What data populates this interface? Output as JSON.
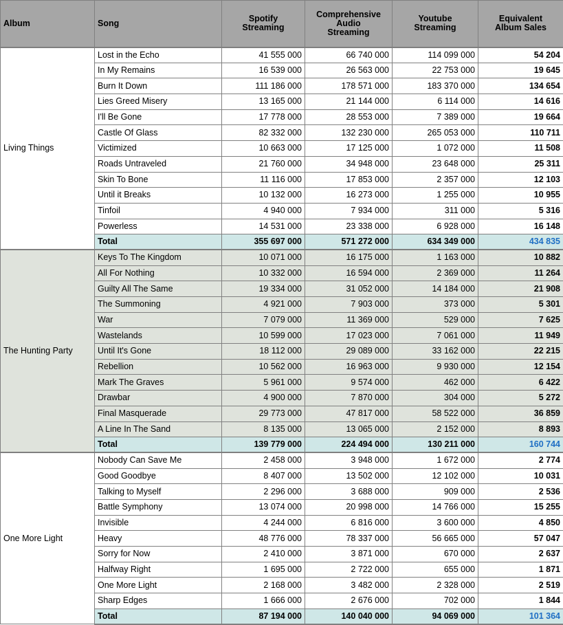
{
  "table": {
    "headers": {
      "album": "Album",
      "song": "Song",
      "spotify": "Spotify Streaming",
      "spotify_line1": "Spotify",
      "spotify_line2": "Streaming",
      "comprehensive_line1": "Comprehensive",
      "comprehensive_line2": "Audio",
      "comprehensive_line3": "Streaming",
      "youtube_line1": "Youtube",
      "youtube_line2": "Streaming",
      "equivalent_line1": "Equivalent",
      "equivalent_line2": "Album Sales"
    },
    "total_label": "Total",
    "colors": {
      "header_bg": "#a6a6a6",
      "total_bg": "#cfe7e7",
      "total_accent_text": "#1f6fc4",
      "section_tint": "#dfe3dc",
      "grid_line": "#808080"
    },
    "sections": [
      {
        "album": "Living Things",
        "rows": [
          {
            "song": "Lost in the Echo",
            "spotify": "41 555 000",
            "comprehensive": "66 740 000",
            "youtube": "114 099 000",
            "equivalent": "54 204"
          },
          {
            "song": "In My Remains",
            "spotify": "16 539 000",
            "comprehensive": "26 563 000",
            "youtube": "22 753 000",
            "equivalent": "19 645"
          },
          {
            "song": "Burn It Down",
            "spotify": "111 186 000",
            "comprehensive": "178 571 000",
            "youtube": "183 370 000",
            "equivalent": "134 654"
          },
          {
            "song": "Lies Greed Misery",
            "spotify": "13 165 000",
            "comprehensive": "21 144 000",
            "youtube": "6 114 000",
            "equivalent": "14 616"
          },
          {
            "song": "I'll Be Gone",
            "spotify": "17 778 000",
            "comprehensive": "28 553 000",
            "youtube": "7 389 000",
            "equivalent": "19 664"
          },
          {
            "song": "Castle Of Glass",
            "spotify": "82 332 000",
            "comprehensive": "132 230 000",
            "youtube": "265 053 000",
            "equivalent": "110 711"
          },
          {
            "song": "Victimized",
            "spotify": "10 663 000",
            "comprehensive": "17 125 000",
            "youtube": "1 072 000",
            "equivalent": "11 508"
          },
          {
            "song": "Roads Untraveled",
            "spotify": "21 760 000",
            "comprehensive": "34 948 000",
            "youtube": "23 648 000",
            "equivalent": "25 311"
          },
          {
            "song": "Skin To Bone",
            "spotify": "11 116 000",
            "comprehensive": "17 853 000",
            "youtube": "2 357 000",
            "equivalent": "12 103"
          },
          {
            "song": "Until it Breaks",
            "spotify": "10 132 000",
            "comprehensive": "16 273 000",
            "youtube": "1 255 000",
            "equivalent": "10 955"
          },
          {
            "song": "Tinfoil",
            "spotify": "4 940 000",
            "comprehensive": "7 934 000",
            "youtube": "311 000",
            "equivalent": "5 316"
          },
          {
            "song": "Powerless",
            "spotify": "14 531 000",
            "comprehensive": "23 338 000",
            "youtube": "6 928 000",
            "equivalent": "16 148"
          }
        ],
        "total": {
          "song": "Total",
          "spotify": "355 697 000",
          "comprehensive": "571 272 000",
          "youtube": "634 349 000",
          "equivalent": "434 835"
        }
      },
      {
        "album": "The Hunting Party",
        "rows": [
          {
            "song": "Keys To The Kingdom",
            "spotify": "10 071 000",
            "comprehensive": "16 175 000",
            "youtube": "1 163 000",
            "equivalent": "10 882"
          },
          {
            "song": "All For Nothing",
            "spotify": "10 332 000",
            "comprehensive": "16 594 000",
            "youtube": "2 369 000",
            "equivalent": "11 264"
          },
          {
            "song": "Guilty All The Same",
            "spotify": "19 334 000",
            "comprehensive": "31 052 000",
            "youtube": "14 184 000",
            "equivalent": "21 908"
          },
          {
            "song": "The Summoning",
            "spotify": "4 921 000",
            "comprehensive": "7 903 000",
            "youtube": "373 000",
            "equivalent": "5 301"
          },
          {
            "song": "War",
            "spotify": "7 079 000",
            "comprehensive": "11 369 000",
            "youtube": "529 000",
            "equivalent": "7 625"
          },
          {
            "song": "Wastelands",
            "spotify": "10 599 000",
            "comprehensive": "17 023 000",
            "youtube": "7 061 000",
            "equivalent": "11 949"
          },
          {
            "song": "Until It's Gone",
            "spotify": "18 112 000",
            "comprehensive": "29 089 000",
            "youtube": "33 162 000",
            "equivalent": "22 215"
          },
          {
            "song": "Rebellion",
            "spotify": "10 562 000",
            "comprehensive": "16 963 000",
            "youtube": "9 930 000",
            "equivalent": "12 154"
          },
          {
            "song": "Mark The Graves",
            "spotify": "5 961 000",
            "comprehensive": "9 574 000",
            "youtube": "462 000",
            "equivalent": "6 422"
          },
          {
            "song": "Drawbar",
            "spotify": "4 900 000",
            "comprehensive": "7 870 000",
            "youtube": "304 000",
            "equivalent": "5 272"
          },
          {
            "song": "Final Masquerade",
            "spotify": "29 773 000",
            "comprehensive": "47 817 000",
            "youtube": "58 522 000",
            "equivalent": "36 859"
          },
          {
            "song": "A Line In The Sand",
            "spotify": "8 135 000",
            "comprehensive": "13 065 000",
            "youtube": "2 152 000",
            "equivalent": "8 893"
          }
        ],
        "total": {
          "song": "Total",
          "spotify": "139 779 000",
          "comprehensive": "224 494 000",
          "youtube": "130 211 000",
          "equivalent": "160 744"
        }
      },
      {
        "album": "One More Light",
        "rows": [
          {
            "song": "Nobody Can Save Me",
            "spotify": "2 458 000",
            "comprehensive": "3 948 000",
            "youtube": "1 672 000",
            "equivalent": "2 774"
          },
          {
            "song": "Good Goodbye",
            "spotify": "8 407 000",
            "comprehensive": "13 502 000",
            "youtube": "12 102 000",
            "equivalent": "10 031"
          },
          {
            "song": "Talking to Myself",
            "spotify": "2 296 000",
            "comprehensive": "3 688 000",
            "youtube": "909 000",
            "equivalent": "2 536"
          },
          {
            "song": "Battle Symphony",
            "spotify": "13 074 000",
            "comprehensive": "20 998 000",
            "youtube": "14 766 000",
            "equivalent": "15 255"
          },
          {
            "song": "Invisible",
            "spotify": "4 244 000",
            "comprehensive": "6 816 000",
            "youtube": "3 600 000",
            "equivalent": "4 850"
          },
          {
            "song": "Heavy",
            "spotify": "48 776 000",
            "comprehensive": "78 337 000",
            "youtube": "56 665 000",
            "equivalent": "57 047"
          },
          {
            "song": "Sorry for Now",
            "spotify": "2 410 000",
            "comprehensive": "3 871 000",
            "youtube": "670 000",
            "equivalent": "2 637"
          },
          {
            "song": "Halfway Right",
            "spotify": "1 695 000",
            "comprehensive": "2 722 000",
            "youtube": "655 000",
            "equivalent": "1 871"
          },
          {
            "song": "One More Light",
            "spotify": "2 168 000",
            "comprehensive": "3 482 000",
            "youtube": "2 328 000",
            "equivalent": "2 519"
          },
          {
            "song": "Sharp Edges",
            "spotify": "1 666 000",
            "comprehensive": "2 676 000",
            "youtube": "702 000",
            "equivalent": "1 844"
          }
        ],
        "total": {
          "song": "Total",
          "spotify": "87 194 000",
          "comprehensive": "140 040 000",
          "youtube": "94 069 000",
          "equivalent": "101 364"
        }
      }
    ]
  }
}
